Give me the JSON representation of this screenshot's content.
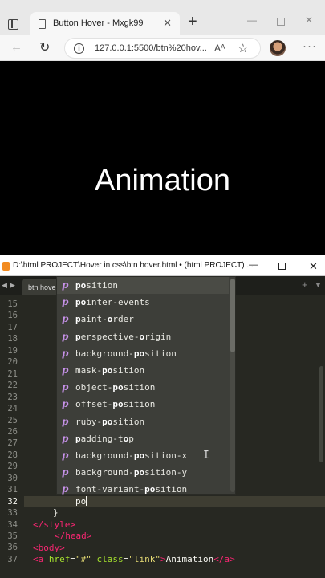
{
  "browser": {
    "tab_title": "Button Hover - Mxgk99",
    "tab_close": "✕",
    "new_tab": "+",
    "url": "127.0.0.1:5500/btn%20hov...",
    "read_aloud": "Aᴬ",
    "controls": {
      "min": "—",
      "close": "✕"
    },
    "page_link_text": "Animation"
  },
  "editor": {
    "title": "D:\\html PROJECT\\Hover in css\\btn hover.html • (html PROJECT) ...",
    "tab_label": "btn hove",
    "controls": {
      "min": "—",
      "close": "✕"
    },
    "line_numbers": [
      "15",
      "16",
      "17",
      "18",
      "19",
      "20",
      "21",
      "22",
      "23",
      "24",
      "25",
      "26",
      "27",
      "28",
      "29",
      "30",
      "31",
      "32",
      "33",
      "34",
      "35",
      "36",
      "37"
    ],
    "current_line": "32",
    "typed_text": "po",
    "line_21_tail": ");",
    "line_34": "</style>",
    "line_35": "</head>",
    "line_36": "<body>",
    "line_37": {
      "open": "<a ",
      "href_attr": "href",
      "href_eq": "=",
      "href_val": "\"#\"",
      "class_attr": " class",
      "class_eq": "=",
      "class_val": "\"link\"",
      "gt": ">",
      "text": "Animation",
      "close": "</a>"
    },
    "brace": "}"
  },
  "autocomplete": {
    "kind_letter": "p",
    "items": [
      {
        "pre": "",
        "bold": "po",
        "post": "sition"
      },
      {
        "pre": "",
        "bold": "po",
        "post": "inter-events"
      },
      {
        "pre": "",
        "bold": "p",
        "post": "aint-",
        "bold2": "o",
        "post2": "rder"
      },
      {
        "pre": "",
        "bold": "p",
        "post": "erspective-",
        "bold2": "o",
        "post2": "rigin"
      },
      {
        "pre": "background-",
        "bold": "po",
        "post": "sition"
      },
      {
        "pre": "mask-",
        "bold": "po",
        "post": "sition"
      },
      {
        "pre": "object-",
        "bold": "po",
        "post": "sition"
      },
      {
        "pre": "offset-",
        "bold": "po",
        "post": "sition"
      },
      {
        "pre": "ruby-",
        "bold": "po",
        "post": "sition"
      },
      {
        "pre": "",
        "bold": "p",
        "post": "adding-t",
        "bold2": "o",
        "post2": "p"
      },
      {
        "pre": "background-",
        "bold": "po",
        "post": "sition-x"
      },
      {
        "pre": "background-",
        "bold": "po",
        "post": "sition-y"
      },
      {
        "pre": "font-variant-",
        "bold": "po",
        "post": "sition"
      }
    ]
  }
}
